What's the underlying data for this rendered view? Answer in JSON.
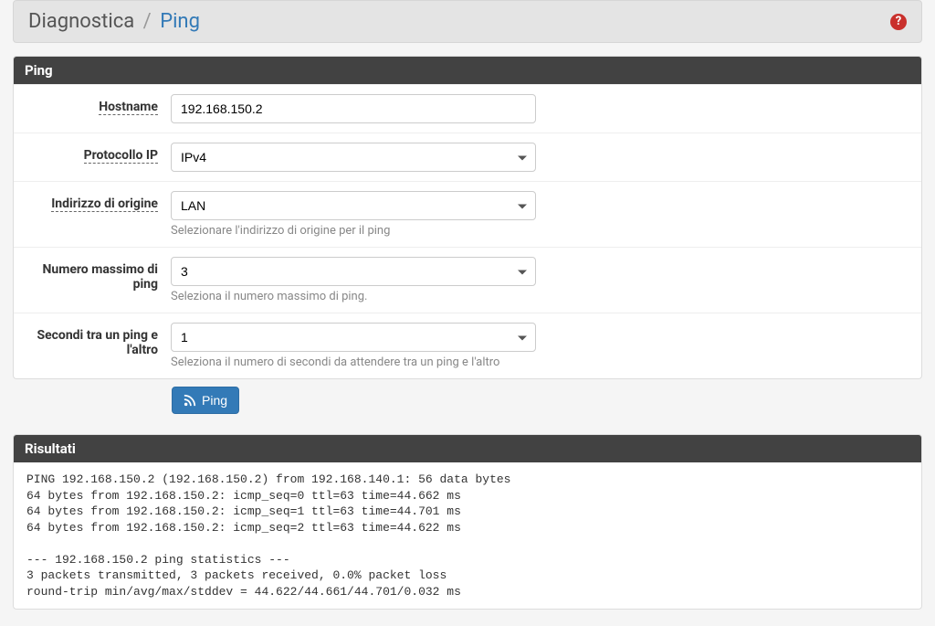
{
  "breadcrumb": {
    "main": "Diagnostica",
    "separator": "/",
    "current": "Ping"
  },
  "helpIcon": "?",
  "panels": {
    "ping": {
      "title": "Ping",
      "fields": {
        "hostname": {
          "label": "Hostname",
          "value": "192.168.150.2"
        },
        "protocol": {
          "label": "Protocollo IP",
          "value": "IPv4"
        },
        "source": {
          "label": "Indirizzo di origine",
          "value": "LAN",
          "help": "Selezionare l'indirizzo di origine per il ping"
        },
        "maxping": {
          "label": "Numero massimo di ping",
          "value": "3",
          "help": "Seleziona il numero massimo di ping."
        },
        "seconds": {
          "label": "Secondi tra un ping e l'altro",
          "value": "1",
          "help": "Seleziona il numero di secondi da attendere tra un ping e l'altro"
        }
      },
      "button": "Ping"
    },
    "results": {
      "title": "Risultati",
      "output": "PING 192.168.150.2 (192.168.150.2) from 192.168.140.1: 56 data bytes\n64 bytes from 192.168.150.2: icmp_seq=0 ttl=63 time=44.662 ms\n64 bytes from 192.168.150.2: icmp_seq=1 ttl=63 time=44.701 ms\n64 bytes from 192.168.150.2: icmp_seq=2 ttl=63 time=44.622 ms\n\n--- 192.168.150.2 ping statistics ---\n3 packets transmitted, 3 packets received, 0.0% packet loss\nround-trip min/avg/max/stddev = 44.622/44.661/44.701/0.032 ms"
    }
  }
}
